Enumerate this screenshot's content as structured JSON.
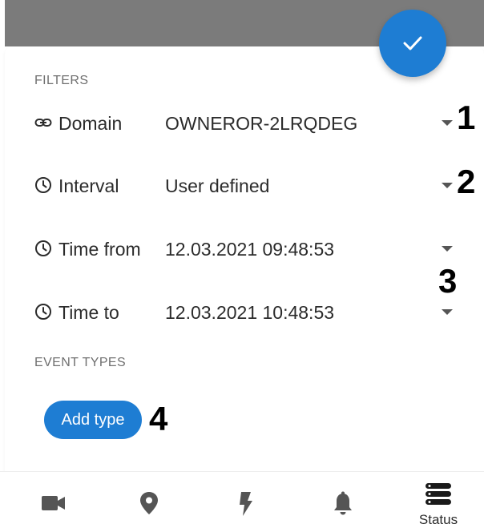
{
  "filters": {
    "heading": "FILTERS",
    "domain": {
      "label": "Domain",
      "value": "OWNEROR-2LRQDEG",
      "icon": "link-icon"
    },
    "interval": {
      "label": "Interval",
      "value": "User defined",
      "icon": "clock-icon"
    },
    "time_from": {
      "label": "Time from",
      "value": "12.03.2021 09:48:53",
      "icon": "clock-icon"
    },
    "time_to": {
      "label": "Time to",
      "value": "12.03.2021 10:48:53",
      "icon": "clock-icon"
    }
  },
  "event_types": {
    "heading": "EVENT TYPES",
    "add_button_label": "Add type"
  },
  "callouts": [
    "1",
    "2",
    "3",
    "4"
  ],
  "nav": {
    "items": [
      "camera-icon",
      "location-pin-icon",
      "lightning-icon",
      "bell-icon",
      "server-stack-icon"
    ],
    "status_label": "Status"
  },
  "colors": {
    "accent": "#1e7dd3",
    "topbar": "#7b7b7b",
    "text": "#2b2b2b",
    "muted": "#6f6f6f",
    "nav_icon": "#555555"
  }
}
